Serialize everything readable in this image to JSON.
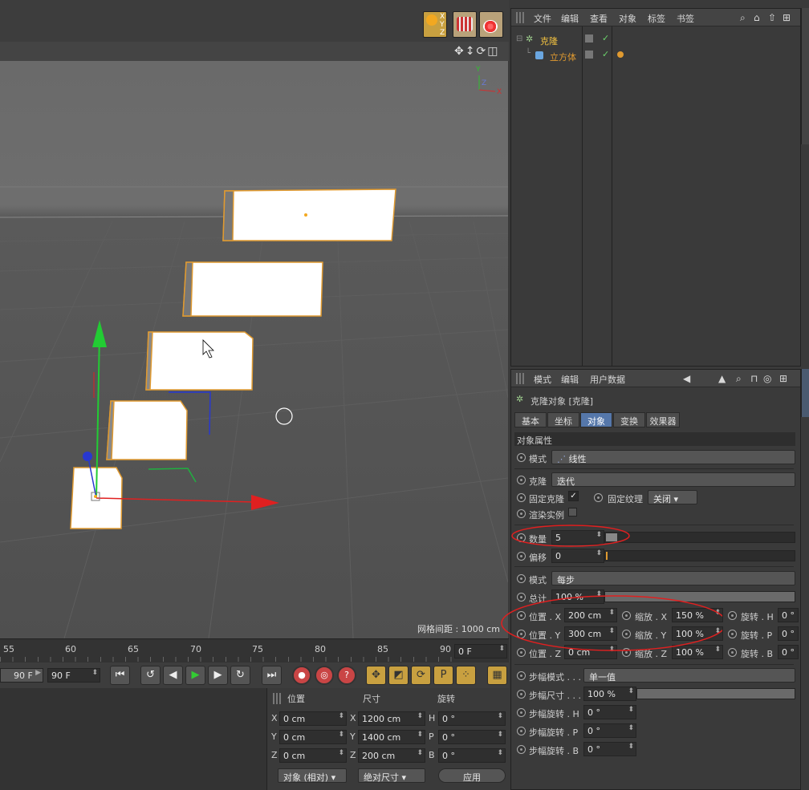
{
  "objects_menu": {
    "items": [
      "文件",
      "编辑",
      "查看",
      "对象",
      "标签",
      "书签"
    ]
  },
  "object_tree": [
    {
      "name": "克隆",
      "color": "#f0c040"
    },
    {
      "name": "立方体",
      "color": "#e09a30"
    }
  ],
  "attr_menu": {
    "items": [
      "模式",
      "编辑",
      "用户数据"
    ]
  },
  "attr_title": "克隆对象 [克隆]",
  "attr_tabs": [
    "基本",
    "坐标",
    "对象",
    "变换",
    "效果器"
  ],
  "active_tab": "对象",
  "section_title": "对象属性",
  "mode": {
    "label": "模式",
    "value": "线性"
  },
  "clone": {
    "label": "克隆",
    "value": "迭代"
  },
  "fix_clone": {
    "label": "固定克隆",
    "checked": true
  },
  "fix_texture": {
    "label": "固定纹理",
    "value": "关闭"
  },
  "render_instance": {
    "label": "渲染实例"
  },
  "count": {
    "label": "数量",
    "value": "5"
  },
  "offset": {
    "label": "偏移",
    "value": "0"
  },
  "step_mode": {
    "label": "模式",
    "value": "每步"
  },
  "total": {
    "label": "总计",
    "value": "100 %"
  },
  "transform_rows": [
    {
      "pos_label": "位置 . X",
      "pos": "200 cm",
      "scale_label": "缩放 . X",
      "scale": "150 %",
      "rot_label": "旋转 . H",
      "rot": "0 °"
    },
    {
      "pos_label": "位置 . Y",
      "pos": "300 cm",
      "scale_label": "缩放 . Y",
      "scale": "100 %",
      "rot_label": "旋转 . P",
      "rot": "0 °"
    },
    {
      "pos_label": "位置 . Z",
      "pos": "0 cm",
      "scale_label": "缩放 . Z",
      "scale": "100 %",
      "rot_label": "旋转 . B",
      "rot": "0 °"
    }
  ],
  "step_rows": [
    {
      "label": "步幅模式 . . .",
      "value": "单一值"
    },
    {
      "label": "步幅尺寸 . . .",
      "value": "100 %"
    },
    {
      "label": "步幅旋转 . H",
      "value": "0 °"
    },
    {
      "label": "步幅旋转 . P",
      "value": "0 °"
    },
    {
      "label": "步幅旋转 . B",
      "value": "0 °"
    }
  ],
  "viewport": {
    "grid_spacing": "网格间距 : 1000 cm"
  },
  "timeline": {
    "ticks": [
      "55",
      "60",
      "65",
      "70",
      "75",
      "80",
      "85",
      "90"
    ],
    "current_frame": "0 F"
  },
  "transport": {
    "start_field": "90 F",
    "end_field": "90 F"
  },
  "coords": {
    "headers": [
      "位置",
      "尺寸",
      "旋转"
    ],
    "rows": [
      {
        "axis": "X",
        "pos": "0 cm",
        "size_axis": "X",
        "size": "1200 cm",
        "rot_axis": "H",
        "rot": "0 °"
      },
      {
        "axis": "Y",
        "pos": "0 cm",
        "size_axis": "Y",
        "size": "1400 cm",
        "rot_axis": "P",
        "rot": "0 °"
      },
      {
        "axis": "Z",
        "pos": "0 cm",
        "size_axis": "Z",
        "size": "200 cm",
        "rot_axis": "B",
        "rot": "0 °"
      }
    ],
    "mode_select": "对象 (相对)",
    "size_select": "绝对尺寸",
    "apply": "应用"
  },
  "colors": {
    "accent": "#5577aa",
    "annotation": "#e02020",
    "selection": "#e09a30"
  }
}
